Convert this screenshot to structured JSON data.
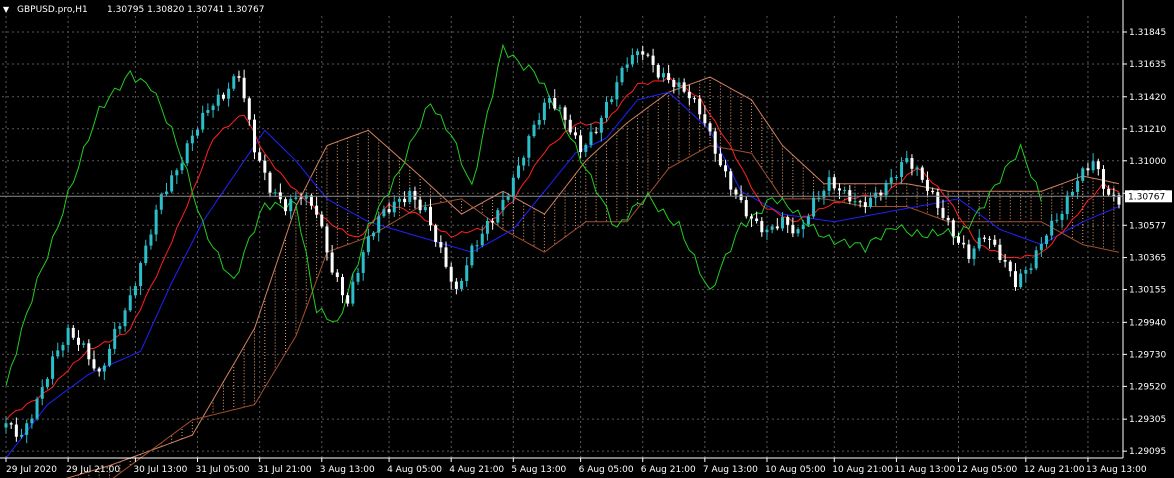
{
  "header": {
    "symbol": "GBPUSD.pro,H1",
    "ohlc": "1.30795 1.30820 1.30741 1.30767"
  },
  "colors": {
    "background": "#000000",
    "grid": "#5a5a5a",
    "text": "#ffffff",
    "candle_up": "#2cbfc9",
    "candle_down": "#ffffff",
    "tenkan": "#ff2020",
    "kijun": "#2020ff",
    "chikou": "#22cc22",
    "cloud": "#f0a070",
    "price_label_bg": "#ffffff",
    "price_label_text": "#000000"
  },
  "chart_data": {
    "type": "candlestick",
    "title": "GBPUSD.pro,H1",
    "indicators": [
      "Ichimoku Kinko Hyo"
    ],
    "grid": true,
    "ylim": [
      1.2905,
      1.3195
    ],
    "y_ticks": [
      "1.31845",
      "1.31635",
      "1.31420",
      "1.31210",
      "1.31000",
      "1.30787",
      "1.30577",
      "1.30365",
      "1.30155",
      "1.29940",
      "1.29730",
      "1.29520",
      "1.29305",
      "1.29095"
    ],
    "x_ticks": [
      "29 Jul 2020",
      "29 Jul 21:00",
      "30 Jul 13:00",
      "31 Jul 05:00",
      "31 Jul 21:00",
      "3 Aug 13:00",
      "4 Aug 05:00",
      "4 Aug 21:00",
      "5 Aug 13:00",
      "6 Aug 05:00",
      "6 Aug 21:00",
      "7 Aug 13:00",
      "10 Aug 05:00",
      "10 Aug 21:00",
      "11 Aug 13:00",
      "12 Aug 05:00",
      "12 Aug 21:00",
      "13 Aug 13:00"
    ],
    "current_price": "1.30767",
    "close_path": [
      [
        0,
        1.2925
      ],
      [
        3,
        1.292
      ],
      [
        6,
        1.2945
      ],
      [
        9,
        1.297
      ],
      [
        12,
        1.2985
      ],
      [
        15,
        1.2975
      ],
      [
        18,
        1.296
      ],
      [
        21,
        1.299
      ],
      [
        24,
        1.301
      ],
      [
        27,
        1.304
      ],
      [
        30,
        1.3075
      ],
      [
        33,
        1.3095
      ],
      [
        36,
        1.312
      ],
      [
        39,
        1.3135
      ],
      [
        42,
        1.314
      ],
      [
        45,
        1.3155
      ],
      [
        48,
        1.311
      ],
      [
        51,
        1.3085
      ],
      [
        54,
        1.307
      ],
      [
        57,
        1.3075
      ],
      [
        60,
        1.3065
      ],
      [
        63,
        1.303
      ],
      [
        66,
        1.301
      ],
      [
        69,
        1.304
      ],
      [
        72,
        1.306
      ],
      [
        75,
        1.307
      ],
      [
        78,
        1.308
      ],
      [
        81,
        1.307
      ],
      [
        84,
        1.304
      ],
      [
        87,
        1.301
      ],
      [
        90,
        1.304
      ],
      [
        93,
        1.306
      ],
      [
        96,
        1.3075
      ],
      [
        99,
        1.3095
      ],
      [
        102,
        1.312
      ],
      [
        105,
        1.314
      ],
      [
        108,
        1.313
      ],
      [
        111,
        1.311
      ],
      [
        114,
        1.312
      ],
      [
        117,
        1.314
      ],
      [
        120,
        1.3165
      ],
      [
        123,
        1.3175
      ],
      [
        126,
        1.316
      ],
      [
        129,
        1.315
      ],
      [
        132,
        1.314
      ],
      [
        135,
        1.3125
      ],
      [
        138,
        1.31
      ],
      [
        141,
        1.308
      ],
      [
        144,
        1.306
      ],
      [
        147,
        1.305
      ],
      [
        150,
        1.306
      ],
      [
        153,
        1.3055
      ],
      [
        156,
        1.3075
      ],
      [
        159,
        1.3085
      ],
      [
        162,
        1.3075
      ],
      [
        165,
        1.307
      ],
      [
        168,
        1.308
      ],
      [
        171,
        1.309
      ],
      [
        174,
        1.31
      ],
      [
        177,
        1.3085
      ],
      [
        180,
        1.307
      ],
      [
        183,
        1.3055
      ],
      [
        186,
        1.304
      ],
      [
        189,
        1.305
      ],
      [
        192,
        1.3035
      ],
      [
        195,
        1.302
      ],
      [
        198,
        1.3035
      ],
      [
        201,
        1.3055
      ],
      [
        204,
        1.3065
      ],
      [
        207,
        1.3085
      ],
      [
        210,
        1.31
      ],
      [
        213,
        1.308
      ],
      [
        215,
        1.30767
      ]
    ],
    "tenkan_path": [
      [
        0,
        1.293
      ],
      [
        8,
        1.295
      ],
      [
        16,
        1.2975
      ],
      [
        24,
        1.299
      ],
      [
        30,
        1.303
      ],
      [
        36,
        1.308
      ],
      [
        40,
        1.3115
      ],
      [
        46,
        1.313
      ],
      [
        50,
        1.3105
      ],
      [
        56,
        1.308
      ],
      [
        62,
        1.306
      ],
      [
        68,
        1.305
      ],
      [
        74,
        1.307
      ],
      [
        80,
        1.3065
      ],
      [
        86,
        1.305
      ],
      [
        92,
        1.3055
      ],
      [
        98,
        1.3075
      ],
      [
        104,
        1.3105
      ],
      [
        110,
        1.3125
      ],
      [
        116,
        1.3125
      ],
      [
        122,
        1.315
      ],
      [
        128,
        1.3155
      ],
      [
        134,
        1.314
      ],
      [
        140,
        1.311
      ],
      [
        146,
        1.307
      ],
      [
        152,
        1.306
      ],
      [
        158,
        1.307
      ],
      [
        164,
        1.3075
      ],
      [
        170,
        1.308
      ],
      [
        176,
        1.3095
      ],
      [
        182,
        1.3075
      ],
      [
        188,
        1.3045
      ],
      [
        194,
        1.3035
      ],
      [
        200,
        1.304
      ],
      [
        206,
        1.306
      ],
      [
        212,
        1.3085
      ],
      [
        215,
        1.308
      ]
    ],
    "kijun_path": [
      [
        0,
        1.2905
      ],
      [
        8,
        1.294
      ],
      [
        16,
        1.296
      ],
      [
        26,
        1.2975
      ],
      [
        32,
        1.302
      ],
      [
        38,
        1.306
      ],
      [
        44,
        1.309
      ],
      [
        50,
        1.312
      ],
      [
        56,
        1.31
      ],
      [
        62,
        1.3075
      ],
      [
        70,
        1.306
      ],
      [
        80,
        1.305
      ],
      [
        90,
        1.304
      ],
      [
        98,
        1.3055
      ],
      [
        104,
        1.308
      ],
      [
        110,
        1.3105
      ],
      [
        116,
        1.3115
      ],
      [
        122,
        1.314
      ],
      [
        128,
        1.3145
      ],
      [
        136,
        1.312
      ],
      [
        142,
        1.308
      ],
      [
        150,
        1.3065
      ],
      [
        160,
        1.306
      ],
      [
        168,
        1.3065
      ],
      [
        176,
        1.307
      ],
      [
        184,
        1.3075
      ],
      [
        192,
        1.3055
      ],
      [
        200,
        1.3045
      ],
      [
        208,
        1.306
      ],
      [
        215,
        1.307
      ]
    ],
    "chikou_path": [
      [
        0,
        1.295
      ],
      [
        6,
        1.302
      ],
      [
        12,
        1.308
      ],
      [
        18,
        1.313
      ],
      [
        24,
        1.316
      ],
      [
        28,
        1.315
      ],
      [
        34,
        1.31
      ],
      [
        38,
        1.306
      ],
      [
        44,
        1.302
      ],
      [
        50,
        1.307
      ],
      [
        56,
        1.3075
      ],
      [
        60,
        1.3
      ],
      [
        64,
        1.299
      ],
      [
        70,
        1.306
      ],
      [
        76,
        1.309
      ],
      [
        82,
        1.314
      ],
      [
        86,
        1.312
      ],
      [
        90,
        1.308
      ],
      [
        96,
        1.3175
      ],
      [
        102,
        1.316
      ],
      [
        108,
        1.312
      ],
      [
        114,
        1.3085
      ],
      [
        118,
        1.3055
      ],
      [
        124,
        1.3075
      ],
      [
        130,
        1.306
      ],
      [
        136,
        1.301
      ],
      [
        142,
        1.306
      ],
      [
        148,
        1.3075
      ],
      [
        154,
        1.306
      ],
      [
        160,
        1.305
      ],
      [
        166,
        1.304
      ],
      [
        172,
        1.306
      ],
      [
        178,
        1.305
      ],
      [
        184,
        1.305
      ],
      [
        190,
        1.308
      ],
      [
        196,
        1.3105
      ],
      [
        200,
        1.3075
      ]
    ],
    "senkou_a_path": [
      [
        0,
        1.288
      ],
      [
        20,
        1.29
      ],
      [
        36,
        1.292
      ],
      [
        48,
        1.299
      ],
      [
        56,
        1.307
      ],
      [
        62,
        1.311
      ],
      [
        70,
        1.312
      ],
      [
        80,
        1.309
      ],
      [
        88,
        1.3065
      ],
      [
        96,
        1.308
      ],
      [
        104,
        1.3065
      ],
      [
        112,
        1.31
      ],
      [
        120,
        1.3125
      ],
      [
        128,
        1.3145
      ],
      [
        136,
        1.3155
      ],
      [
        144,
        1.314
      ],
      [
        150,
        1.311
      ],
      [
        158,
        1.3085
      ],
      [
        166,
        1.3085
      ],
      [
        174,
        1.3085
      ],
      [
        182,
        1.308
      ],
      [
        190,
        1.308
      ],
      [
        200,
        1.308
      ],
      [
        208,
        1.309
      ],
      [
        215,
        1.3085
      ]
    ],
    "senkou_b_path": [
      [
        0,
        1.288
      ],
      [
        20,
        1.289
      ],
      [
        36,
        1.293
      ],
      [
        48,
        1.294
      ],
      [
        56,
        1.2985
      ],
      [
        62,
        1.304
      ],
      [
        70,
        1.305
      ],
      [
        80,
        1.307
      ],
      [
        88,
        1.3075
      ],
      [
        96,
        1.3055
      ],
      [
        104,
        1.304
      ],
      [
        112,
        1.306
      ],
      [
        120,
        1.306
      ],
      [
        128,
        1.3095
      ],
      [
        136,
        1.311
      ],
      [
        144,
        1.3105
      ],
      [
        150,
        1.3075
      ],
      [
        158,
        1.3075
      ],
      [
        166,
        1.307
      ],
      [
        174,
        1.307
      ],
      [
        182,
        1.306
      ],
      [
        190,
        1.306
      ],
      [
        200,
        1.306
      ],
      [
        208,
        1.3045
      ],
      [
        215,
        1.304
      ]
    ]
  }
}
